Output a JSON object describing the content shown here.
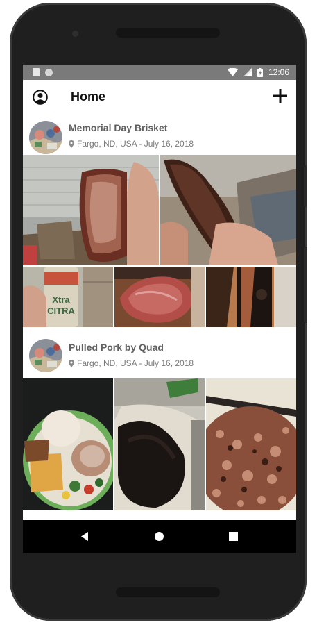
{
  "status_bar": {
    "time": "12:06"
  },
  "toolbar": {
    "title": "Home"
  },
  "posts": [
    {
      "title": "Memorial Day Brisket",
      "location": "Fargo, ND, USA - July 16, 2018"
    },
    {
      "title": "Pulled Pork by Quad",
      "location": "Fargo, ND, USA - July 16, 2018"
    }
  ],
  "photo_text": {
    "can": "Xtra\nCITRA"
  },
  "nav": {
    "back": "back-icon",
    "home": "home-icon",
    "recents": "recents-icon"
  }
}
